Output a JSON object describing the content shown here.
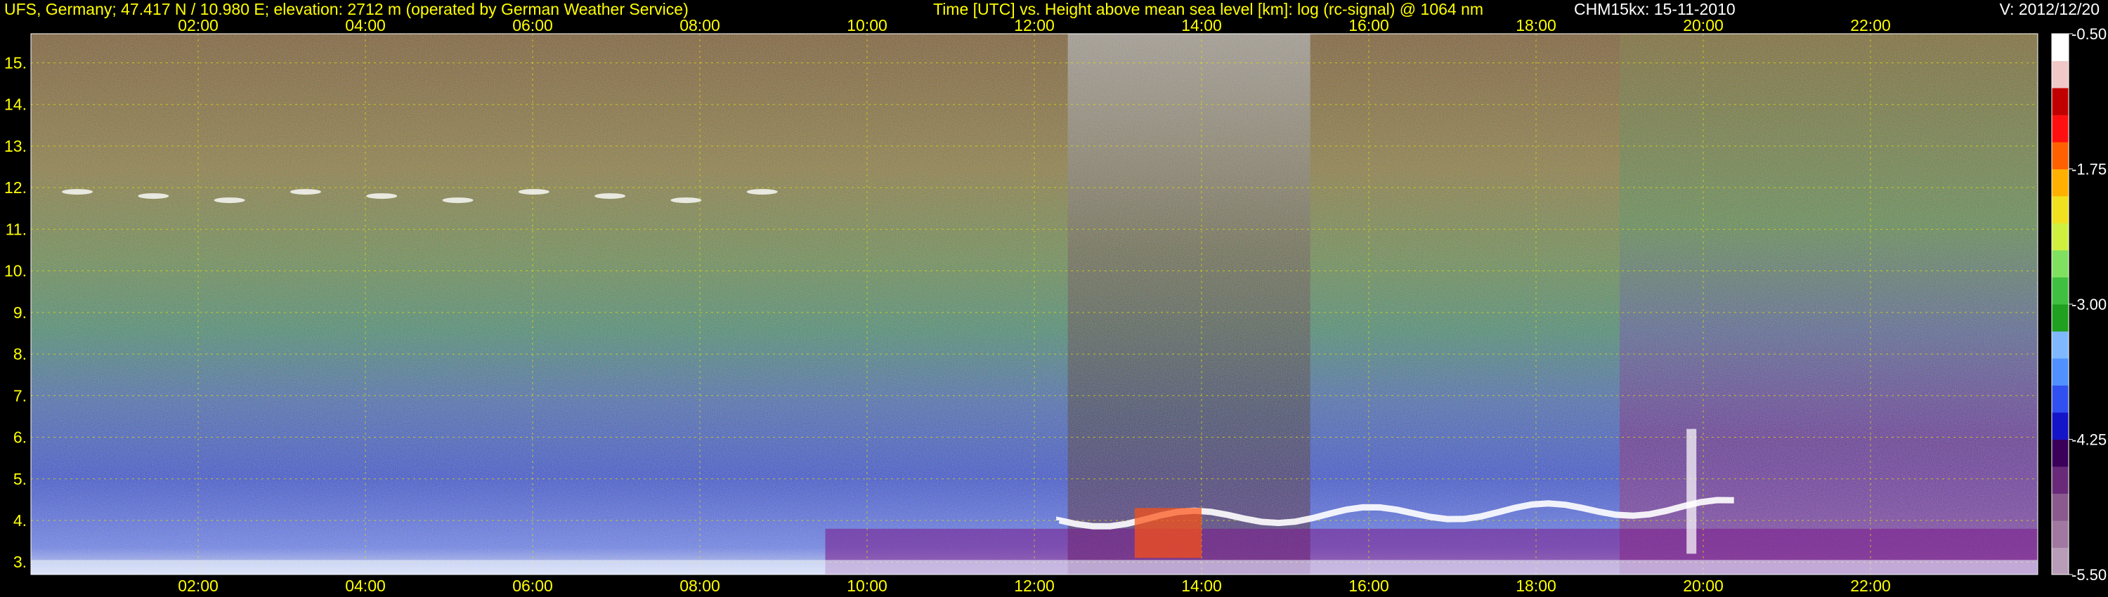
{
  "header": {
    "station": "UFS, Germany; 47.417 N / 10.980 E; elevation: 2712 m  (operated by German Weather Service)",
    "plot_title": "Time [UTC] vs. Height above mean sea level [km]: log (rc-signal) @ 1064 nm",
    "instrument_date": "CHM15kx: 15-11-2010",
    "version": "V: 2012/12/20"
  },
  "chart_data": {
    "type": "heatmap",
    "title": "Time [UTC] vs. Height above mean sea level [km]: log (rc-signal) @ 1064 nm",
    "xlabel": "Time [UTC]",
    "ylabel": "Height above mean sea level [km]",
    "x_ticks": [
      "02:00",
      "04:00",
      "06:00",
      "08:00",
      "10:00",
      "12:00",
      "14:00",
      "16:00",
      "18:00",
      "20:00",
      "22:00"
    ],
    "x_tick_hours": [
      2,
      4,
      6,
      8,
      10,
      12,
      14,
      16,
      18,
      20,
      22
    ],
    "xlim_hours": [
      0,
      24
    ],
    "y_ticks": [
      "3.",
      "4.",
      "5.",
      "6.",
      "7.",
      "8.",
      "9.",
      "10.",
      "11.",
      "12.",
      "13.",
      "14.",
      "15."
    ],
    "y_tick_values": [
      3,
      4,
      5,
      6,
      7,
      8,
      9,
      10,
      11,
      12,
      13,
      14,
      15
    ],
    "ylim": [
      2.7,
      15.7
    ],
    "grid": true,
    "colorbar": {
      "ticks": [
        "-0.50",
        "-1.75",
        "-3.00",
        "-4.25",
        "-5.50"
      ],
      "tick_values": [
        -0.5,
        -1.75,
        -3.0,
        -4.25,
        -5.5
      ],
      "range": [
        -5.5,
        -0.5
      ],
      "colors": [
        "#b89cb8",
        "#a078a0",
        "#8a5a8e",
        "#6a2a7a",
        "#3a005a",
        "#1414c8",
        "#3050f0",
        "#5090ff",
        "#80b8ff",
        "#20a020",
        "#40c040",
        "#80e060",
        "#d0f040",
        "#f0e020",
        "#ffb000",
        "#ff6000",
        "#ff1010",
        "#c00000",
        "#f0c8c8",
        "#ffffff"
      ]
    },
    "features": [
      {
        "name": "cloud layer",
        "start_hour": 12.3,
        "end_hour": 20.5,
        "height_km": 4.0
      },
      {
        "name": "cirrus traces",
        "start_hour": 0.1,
        "end_hour": 9.2,
        "height_km": 11.9
      },
      {
        "name": "low boundary layer",
        "start_hour": 0.0,
        "end_hour": 24.0,
        "height_km": 3.0
      }
    ]
  }
}
